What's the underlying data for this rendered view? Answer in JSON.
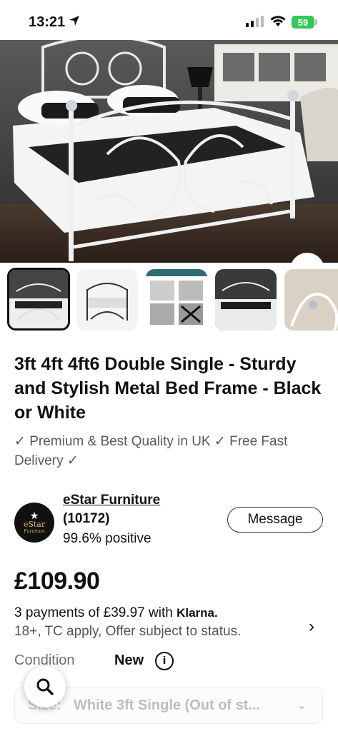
{
  "status_bar": {
    "time": "13:21",
    "battery": "59"
  },
  "listing": {
    "title": "3ft 4ft 4ft6 Double Single - Sturdy and Stylish Metal Bed Frame - Black or White",
    "subtitle": "✓ Premium & Best Quality in UK ✓ Free Fast Delivery ✓",
    "thumbnail_count": 5,
    "selected_thumbnail": 1
  },
  "seller": {
    "logo_text": "eStar",
    "logo_subtext": "Furniture",
    "name": "eStar Furniture",
    "feedback_count": "(10172)",
    "feedback_percent": "99.6% positive",
    "message_label": "Message"
  },
  "price": {
    "amount": "£109.90",
    "installments_prefix": "3 payments of £39.97 with",
    "provider": "Klarna.",
    "terms": "18+, TC apply, Offer subject to status."
  },
  "condition": {
    "label": "Condition",
    "value": "New"
  },
  "size": {
    "label": "Size:",
    "value": "White 3ft Single (Out of st..."
  },
  "colors": {
    "accent": "#34c759",
    "text": "#111111",
    "muted": "#707070"
  }
}
